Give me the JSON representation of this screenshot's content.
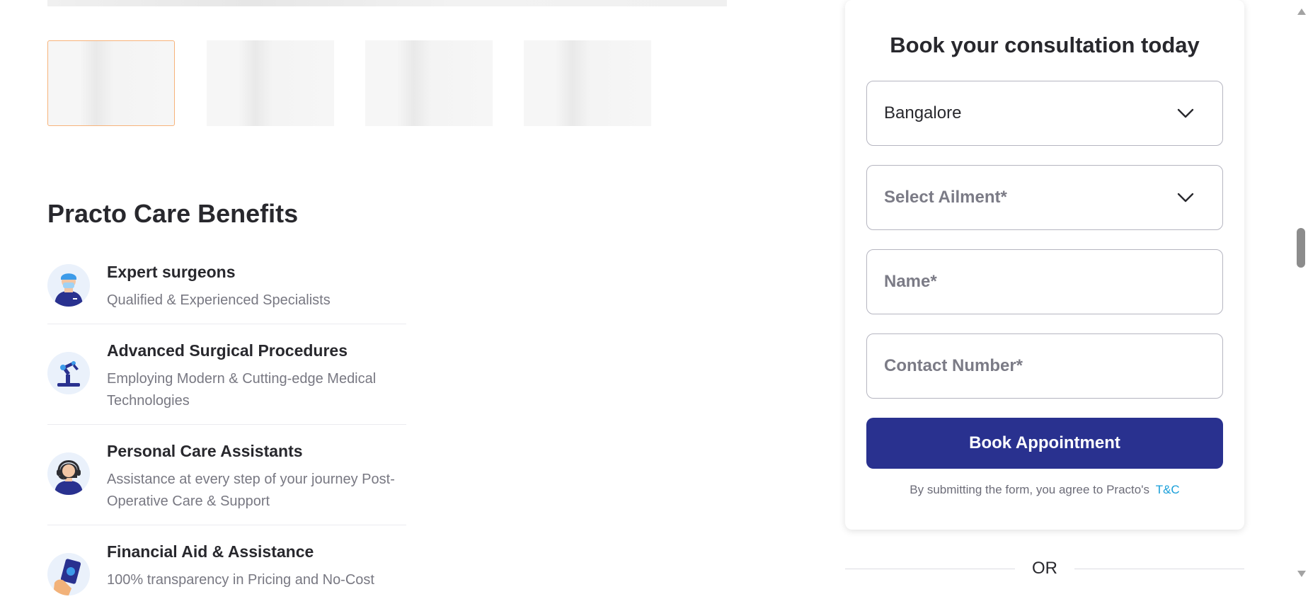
{
  "gallery": {
    "thumbnail_count": 4,
    "active_index": 0
  },
  "benefits": {
    "title": "Practo Care Benefits",
    "items": [
      {
        "icon": "surgeon-icon",
        "title": "Expert surgeons",
        "description": "Qualified & Experienced Specialists"
      },
      {
        "icon": "robotic-arm-icon",
        "title": "Advanced Surgical Procedures",
        "description": "Employing Modern & Cutting-edge Medical Technologies"
      },
      {
        "icon": "care-assistant-icon",
        "title": "Personal Care Assistants",
        "description": "Assistance at every step of your journey Post-Operative Care & Support"
      },
      {
        "icon": "money-hand-icon",
        "title": "Financial Aid & Assistance",
        "description": "100% transparency in Pricing and No-Cost"
      }
    ]
  },
  "booking_form": {
    "title": "Book your consultation today",
    "city_select": {
      "value": "Bangalore"
    },
    "ailment_select": {
      "placeholder": "Select Ailment*"
    },
    "name_input": {
      "placeholder": "Name*"
    },
    "contact_input": {
      "placeholder": "Contact Number*"
    },
    "submit_label": "Book Appointment",
    "consent_text": "By submitting the form, you agree to Practo's",
    "consent_link": "T&C"
  },
  "divider": {
    "text": "OR"
  },
  "colors": {
    "primary_button": "#29318f",
    "link": "#199fd9",
    "active_thumbnail_border": "#f7b37a"
  }
}
